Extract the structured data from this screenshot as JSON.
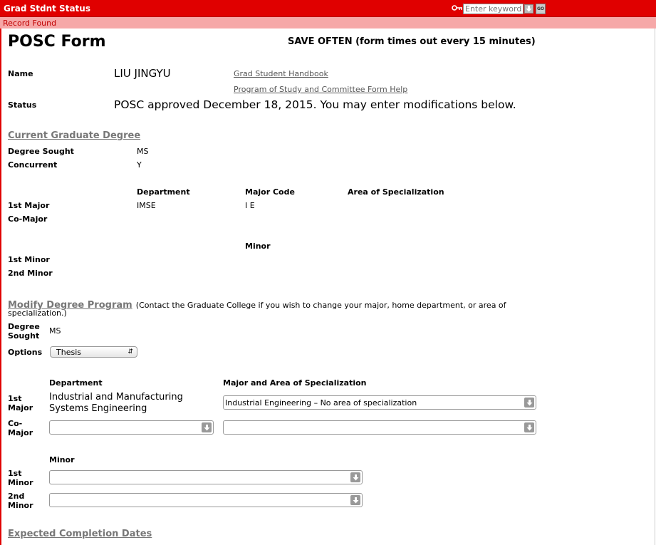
{
  "app": {
    "title": "Grad Stdnt Status"
  },
  "search": {
    "placeholder": "Enter keyword",
    "go_label": "GO"
  },
  "message": "Record Found",
  "form": {
    "title": "POSC Form",
    "save_note": "SAVE OFTEN (form times out every 15 minutes)"
  },
  "student": {
    "name_label": "Name",
    "name_value": "LIU JINGYU",
    "status_label": "Status",
    "status_value": "POSC approved December 18, 2015. You may enter modifications below."
  },
  "links": {
    "handbook": "Grad Student Handbook",
    "help": "Program of Study and Committee Form Help"
  },
  "current_degree": {
    "heading": "Current Graduate Degree",
    "degree_sought_label": "Degree Sought",
    "degree_sought_value": "MS",
    "concurrent_label": "Concurrent",
    "concurrent_value": "Y",
    "columns": {
      "department": "Department",
      "major_code": "Major Code",
      "area": "Area of Specialization",
      "minor": "Minor"
    },
    "first_major_label": "1st Major",
    "first_major_department": "IMSE",
    "first_major_code": "I E",
    "co_major_label": "Co-Major",
    "first_minor_label": "1st Minor",
    "second_minor_label": "2nd Minor"
  },
  "modify": {
    "heading": "Modify Degree Program",
    "note_line1": "(Contact the Graduate College if you wish to change your major, home department, or area of",
    "note_line2": "specialization.)",
    "degree_label_line1": "Degree",
    "degree_label_line2": "Sought",
    "degree_value": "MS",
    "options_label": "Options",
    "options_value": "Thesis",
    "columns": {
      "department": "Department",
      "major_area": "Major and Area of Specialization",
      "minor": "Minor"
    },
    "first_major_label_line1": "1st",
    "first_major_label_line2": "Major",
    "first_major_department_line1": "Industrial and Manufacturing",
    "first_major_department_line2": "Systems Engineering",
    "first_major_area_value": "Industrial Engineering  –  No area of specialization",
    "co_major_label_line1": "Co-",
    "co_major_label_line2": "Major",
    "first_minor_label_line1": "1st",
    "first_minor_label_line2": "Minor",
    "second_minor_label_line1": "2nd",
    "second_minor_label_line2": "Minor"
  },
  "completion": {
    "heading": "Expected Completion Dates"
  },
  "colors": {
    "topbar": "#e00000",
    "message_bar": "#f6a8a8",
    "message_text": "#c00000",
    "section_heading": "#777777"
  }
}
